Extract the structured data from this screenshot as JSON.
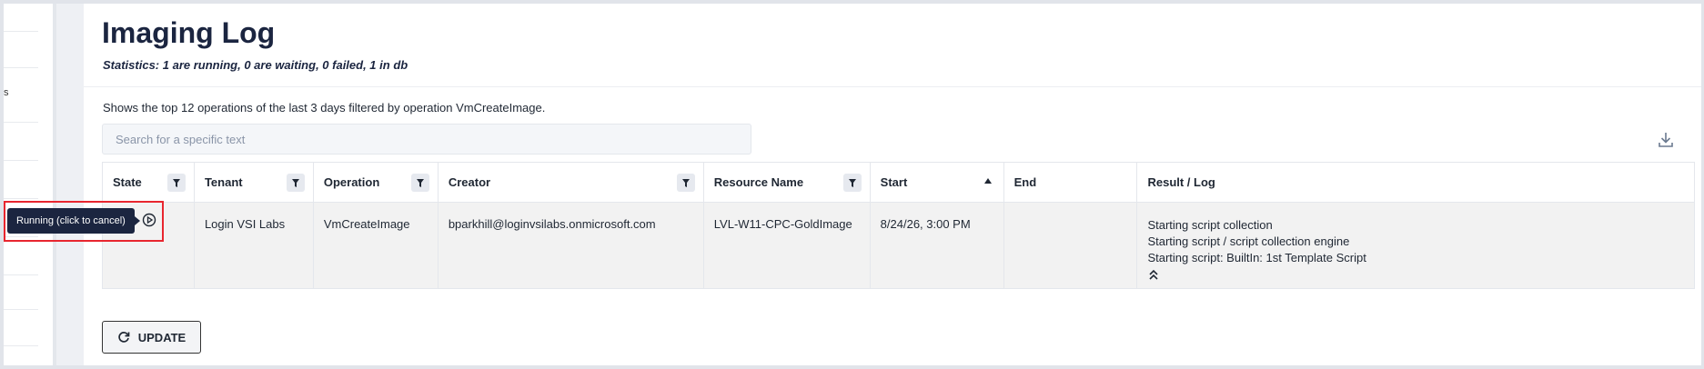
{
  "page": {
    "title": "Imaging Log",
    "statistics": "Statistics: 1 are running, 0 are waiting, 0 failed, 1 in db",
    "description": "Shows the top 12 operations of the last 3 days filtered by operation VmCreateImage."
  },
  "sidebar": {
    "partial_text": "s"
  },
  "search": {
    "placeholder": "Search for a specific text",
    "value": ""
  },
  "table": {
    "columns": [
      {
        "label": "State",
        "filter": true
      },
      {
        "label": "Tenant",
        "filter": true
      },
      {
        "label": "Operation",
        "filter": true
      },
      {
        "label": "Creator",
        "filter": true
      },
      {
        "label": "Resource Name",
        "filter": true
      },
      {
        "label": "Start",
        "sort": "ascending"
      },
      {
        "label": "End"
      },
      {
        "label": "Result / Log"
      }
    ],
    "rows": [
      {
        "state": "running",
        "tenant": "Login VSI Labs",
        "operation": "VmCreateImage",
        "creator": "bparkhill@loginvsilabs.onmicrosoft.com",
        "resource_name": "LVL-W11-CPC-GoldImage",
        "start": "8/24/26, 3:00 PM",
        "end": "",
        "log": [
          "Starting script collection",
          "Starting script / script collection engine",
          "Starting script: BuiltIn: 1st Template Script"
        ]
      }
    ]
  },
  "tooltip": {
    "text": "Running (click to cancel)"
  },
  "actions": {
    "update_label": "UPDATE"
  },
  "icons": {
    "filter": "filter-icon",
    "sort": "sort-ascending-icon",
    "download": "download-icon",
    "running": "play-circle-icon",
    "collapse": "double-chevron-up-icon",
    "refresh": "refresh-icon"
  },
  "colors": {
    "highlight": "#e8262f",
    "title": "#1b2540",
    "row_bg": "#f2f2f2"
  }
}
